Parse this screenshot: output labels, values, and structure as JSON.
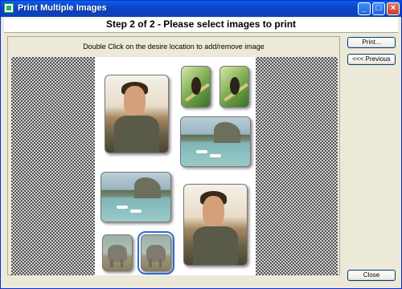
{
  "window": {
    "title": "Print Multiple Images",
    "controls": {
      "minimize": "_",
      "maximize": "□",
      "close": "×"
    }
  },
  "header": {
    "text": "Step 2 of 2 - Please select images to print"
  },
  "instruction": "Double Click on the desire location to add/remove image",
  "buttons": {
    "print": "Print...",
    "previous": "<<< Previous",
    "close": "Close"
  },
  "canvas": {
    "slots": [
      {
        "name": "portrait-man-1",
        "image": "man-portrait"
      },
      {
        "name": "bird-1",
        "image": "bird-on-branch"
      },
      {
        "name": "bird-2",
        "image": "bird-on-branch"
      },
      {
        "name": "beach-1",
        "image": "beach-with-boats"
      },
      {
        "name": "beach-2",
        "image": "beach-with-boats"
      },
      {
        "name": "portrait-man-2",
        "image": "man-portrait"
      },
      {
        "name": "elephant-1",
        "image": "elephant"
      },
      {
        "name": "elephant-2",
        "image": "elephant",
        "selected": true
      }
    ]
  }
}
